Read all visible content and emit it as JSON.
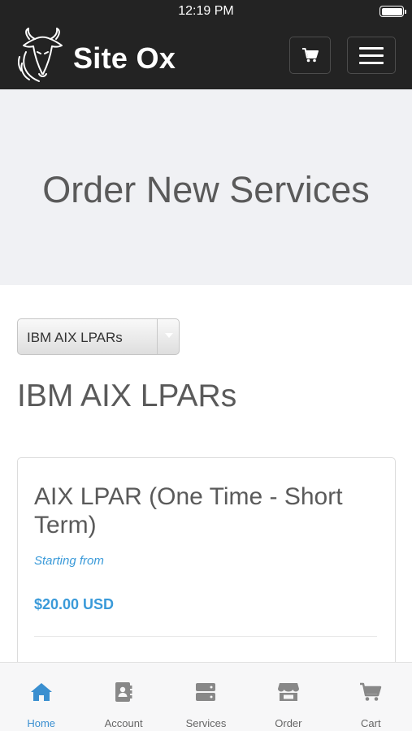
{
  "status_bar": {
    "time": "12:19 PM"
  },
  "header": {
    "brand": "Site Ox"
  },
  "hero": {
    "title": "Order New Services"
  },
  "category_select": {
    "selected": "IBM AIX LPARs"
  },
  "category_title": "IBM AIX LPARs",
  "product": {
    "name": "AIX LPAR (One Time - Short Term)",
    "starting_from_label": "Starting from",
    "price": "$20.00 USD"
  },
  "tabbar": {
    "tabs": [
      {
        "label": "Home",
        "icon": "home-icon",
        "active": true
      },
      {
        "label": "Account",
        "icon": "address-book-icon",
        "active": false
      },
      {
        "label": "Services",
        "icon": "server-icon",
        "active": false
      },
      {
        "label": "Order",
        "icon": "store-icon",
        "active": false
      },
      {
        "label": "Cart",
        "icon": "cart-icon",
        "active": false
      }
    ]
  },
  "colors": {
    "header_bg": "#232323",
    "hero_bg": "#f0f1f4",
    "accent": "#3a9ad9",
    "text": "#5a5a5a"
  }
}
